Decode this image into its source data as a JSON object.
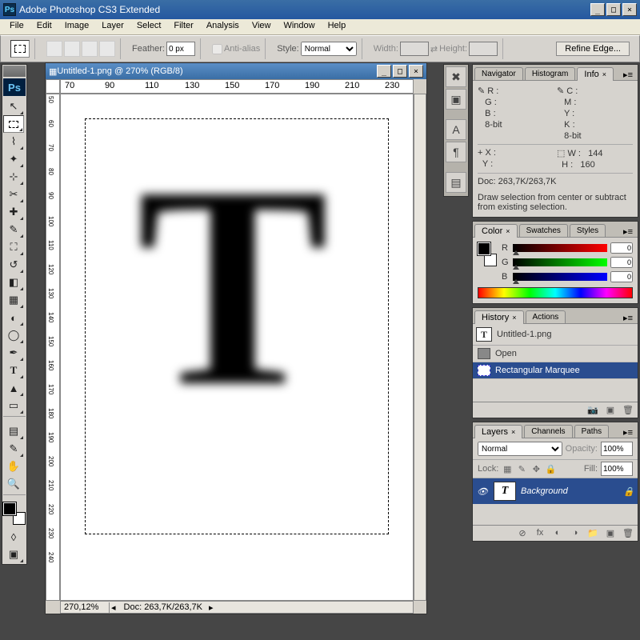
{
  "titlebar": {
    "app_title": "Adobe Photoshop CS3 Extended",
    "ps": "Ps"
  },
  "menu": {
    "file": "File",
    "edit": "Edit",
    "image": "Image",
    "layer": "Layer",
    "select": "Select",
    "filter": "Filter",
    "analysis": "Analysis",
    "view": "View",
    "window": "Window",
    "help": "Help"
  },
  "options_bar": {
    "feather_label": "Feather:",
    "feather_value": "0 px",
    "antialias": "Anti-alias",
    "style_label": "Style:",
    "style_value": "Normal",
    "width_label": "Width:",
    "width_value": "",
    "height_label": "Height:",
    "height_value": "",
    "refine_edge": "Refine Edge..."
  },
  "document": {
    "title": "Untitled-1.png @ 270% (RGB/8)",
    "zoom_status": "270,12%",
    "doc_status": "Doc: 263,7K/263,7K",
    "letter": "T",
    "ruler_h": [
      "70",
      "90",
      "110",
      "130",
      "150",
      "170",
      "190",
      "210",
      "230"
    ],
    "ruler_v": [
      "50",
      "60",
      "70",
      "80",
      "90",
      "100",
      "110",
      "120",
      "130",
      "140",
      "150",
      "160",
      "170",
      "180",
      "190",
      "200",
      "210",
      "220",
      "230",
      "240"
    ]
  },
  "info_panel": {
    "tabs": {
      "navigator": "Navigator",
      "histogram": "Histogram",
      "info": "Info"
    },
    "rgb": {
      "r": "R :",
      "g": "G :",
      "b": "B :",
      "bit": "8-bit"
    },
    "cmyk": {
      "c": "C :",
      "m": "M :",
      "y": "Y :",
      "k": "K :",
      "bit": "8-bit"
    },
    "xy": {
      "x": "X :",
      "y": "Y :"
    },
    "wh": {
      "w": "W :",
      "h": "H :",
      "wv": "144",
      "hv": "160"
    },
    "doc": "Doc: 263,7K/263,7K",
    "hint": "Draw selection from center or subtract from existing selection."
  },
  "strip": {
    "characters": "A",
    "paragraph": "¶"
  },
  "color_panel": {
    "tabs": {
      "color": "Color",
      "swatches": "Swatches",
      "styles": "Styles"
    },
    "r": "R",
    "g": "G",
    "b": "B",
    "val": "0"
  },
  "history_panel": {
    "tabs": {
      "history": "History",
      "actions": "Actions"
    },
    "doc_name": "Untitled-1.png",
    "items": [
      "Open",
      "Rectangular Marquee"
    ]
  },
  "layers_panel": {
    "tabs": {
      "layers": "Layers",
      "channels": "Channels",
      "paths": "Paths"
    },
    "blend": "Normal",
    "opacity_label": "Opacity:",
    "opacity": "100%",
    "lock_label": "Lock:",
    "fill_label": "Fill:",
    "fill": "100%",
    "layer_name": "Background"
  }
}
